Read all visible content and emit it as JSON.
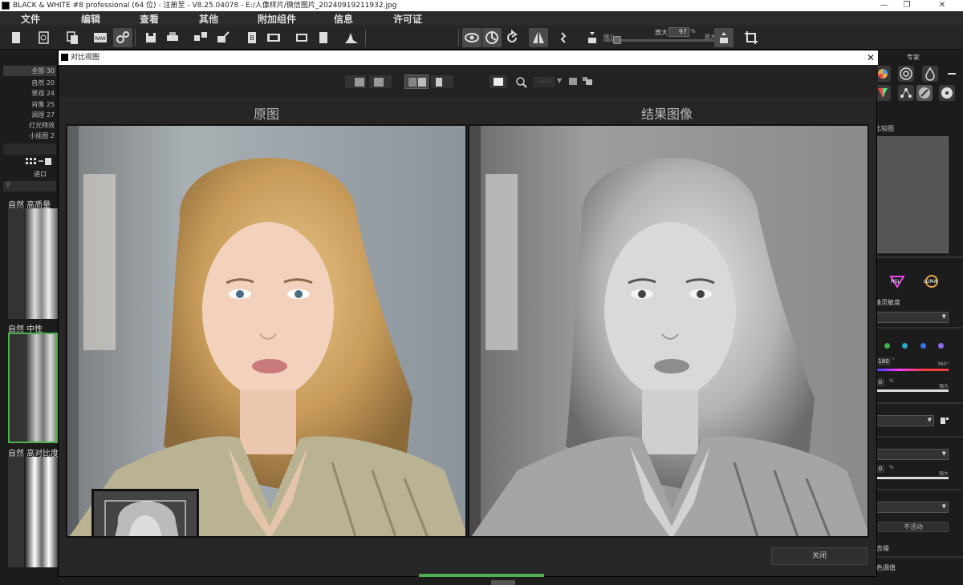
{
  "window": {
    "title": "BLACK & WHITE #8 professional (64 位) - 注册至 - V8.25.04078 - E:/人像样片/微信图片_20240919211932.jpg",
    "controls": [
      "—",
      "❐",
      "✕"
    ]
  },
  "menu": [
    "文件",
    "编辑",
    "查看",
    "其他",
    "附加组件",
    "信息",
    "许可证"
  ],
  "toolbar": {
    "zoom_title": "放大",
    "zoom_value": "97",
    "zoom_unit": "%",
    "zoom_small_label": "缩小",
    "zoom_big_label": "放大",
    "zoom_level": 0.12
  },
  "left_panel": {
    "categories": [
      {
        "label": "全部",
        "count": "30",
        "selected": true
      },
      {
        "label": "自然",
        "count": "20",
        "selected": false
      },
      {
        "label": "景观",
        "count": "24",
        "selected": false
      },
      {
        "label": "肖像",
        "count": "25",
        "selected": false
      },
      {
        "label": "调理",
        "count": "27",
        "selected": false
      },
      {
        "label": "灯光特效",
        "count": "",
        "selected": false
      },
      {
        "label": "小插图",
        "count": "2",
        "selected": false
      }
    ],
    "import_label": "进口",
    "presets": [
      {
        "title": "自然  高质量",
        "selected": false
      },
      {
        "title": "自然  中性",
        "selected": true
      },
      {
        "title": "自然  高对比度",
        "selected": false
      }
    ]
  },
  "dialog": {
    "title": "对比视图",
    "close_symbol": "✕",
    "zoom_readout": "100%",
    "label_left": "原图",
    "label_right": "结果图像",
    "close_button": "关闭"
  },
  "right_panel": {
    "title": "专家",
    "compare_label": "比较图",
    "hsl_label": "HSL",
    "luma_label": "LUMA",
    "section_label": "精灵敏度",
    "hue_value": "180",
    "hue_unit": "°",
    "hue_max": "360°",
    "strength_value": "0",
    "strength_unit": "%",
    "strength_max": "强大",
    "value2": "0",
    "value2_unit": "%",
    "value2_max": "强大",
    "inactive_label": "不活动",
    "denoise_label": "去噪",
    "tone_label": "色调值",
    "dot_colors": [
      "#3cb043",
      "#2aa7c9",
      "#3b6ee8",
      "#8a6ee8"
    ]
  }
}
